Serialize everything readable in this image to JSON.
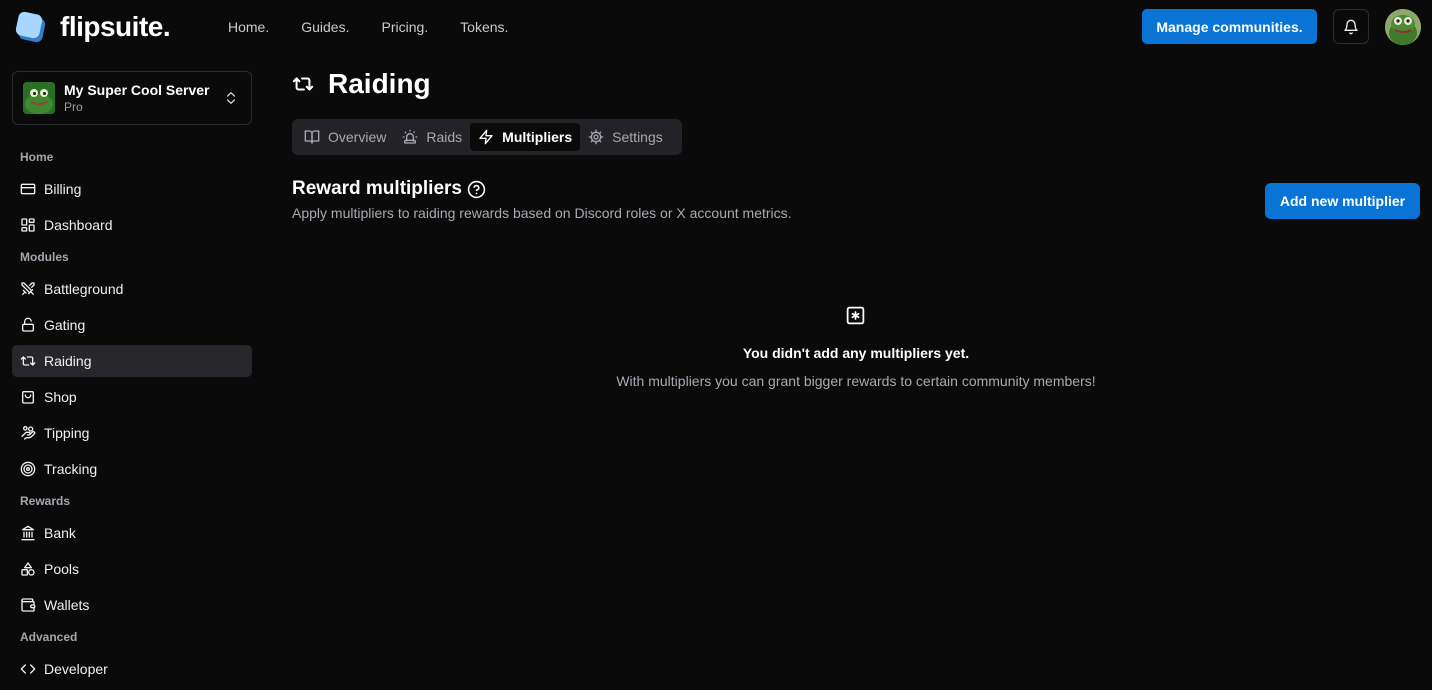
{
  "brand": {
    "name": "flipsuite.",
    "color": "#5aa8f0"
  },
  "topnav": {
    "links": [
      "Home.",
      "Guides.",
      "Pricing.",
      "Tokens."
    ],
    "manage_label": "Manage communities."
  },
  "server": {
    "name": "My Super Cool Server",
    "plan": "Pro"
  },
  "sidebar": {
    "sections": {
      "home": "Home",
      "modules": "Modules",
      "rewards": "Rewards",
      "advanced": "Advanced"
    },
    "items": [
      {
        "label": "Billing",
        "icon": "credit-card-icon"
      },
      {
        "label": "Dashboard",
        "icon": "layout-grid-icon"
      },
      {
        "label": "Battleground",
        "icon": "swords-icon"
      },
      {
        "label": "Gating",
        "icon": "lock-icon"
      },
      {
        "label": "Raiding",
        "icon": "repeat-icon",
        "active": true
      },
      {
        "label": "Shop",
        "icon": "shopping-bag-icon"
      },
      {
        "label": "Tipping",
        "icon": "hand-coins-icon"
      },
      {
        "label": "Tracking",
        "icon": "target-icon"
      },
      {
        "label": "Bank",
        "icon": "landmark-icon"
      },
      {
        "label": "Pools",
        "icon": "shapes-icon"
      },
      {
        "label": "Wallets",
        "icon": "wallet-icon"
      },
      {
        "label": "Developer",
        "icon": "code-icon"
      }
    ]
  },
  "page": {
    "title": "Raiding"
  },
  "tabs": [
    {
      "label": "Overview",
      "icon": "book-open-icon"
    },
    {
      "label": "Raids",
      "icon": "siren-icon"
    },
    {
      "label": "Multipliers",
      "icon": "zap-icon",
      "active": true
    },
    {
      "label": "Settings",
      "icon": "settings-icon"
    }
  ],
  "section": {
    "title": "Reward multipliers",
    "description": "Apply multipliers to raiding rewards based on Discord roles or X account metrics.",
    "add_label": "Add new multiplier"
  },
  "empty": {
    "icon": "square-asterisk-icon",
    "title": "You didn't add any multipliers yet.",
    "description": "With multipliers you can grant bigger rewards to certain community members!"
  },
  "colors": {
    "accent": "#0a74d6",
    "background": "#0a0a0b",
    "active_item": "#27272b"
  }
}
